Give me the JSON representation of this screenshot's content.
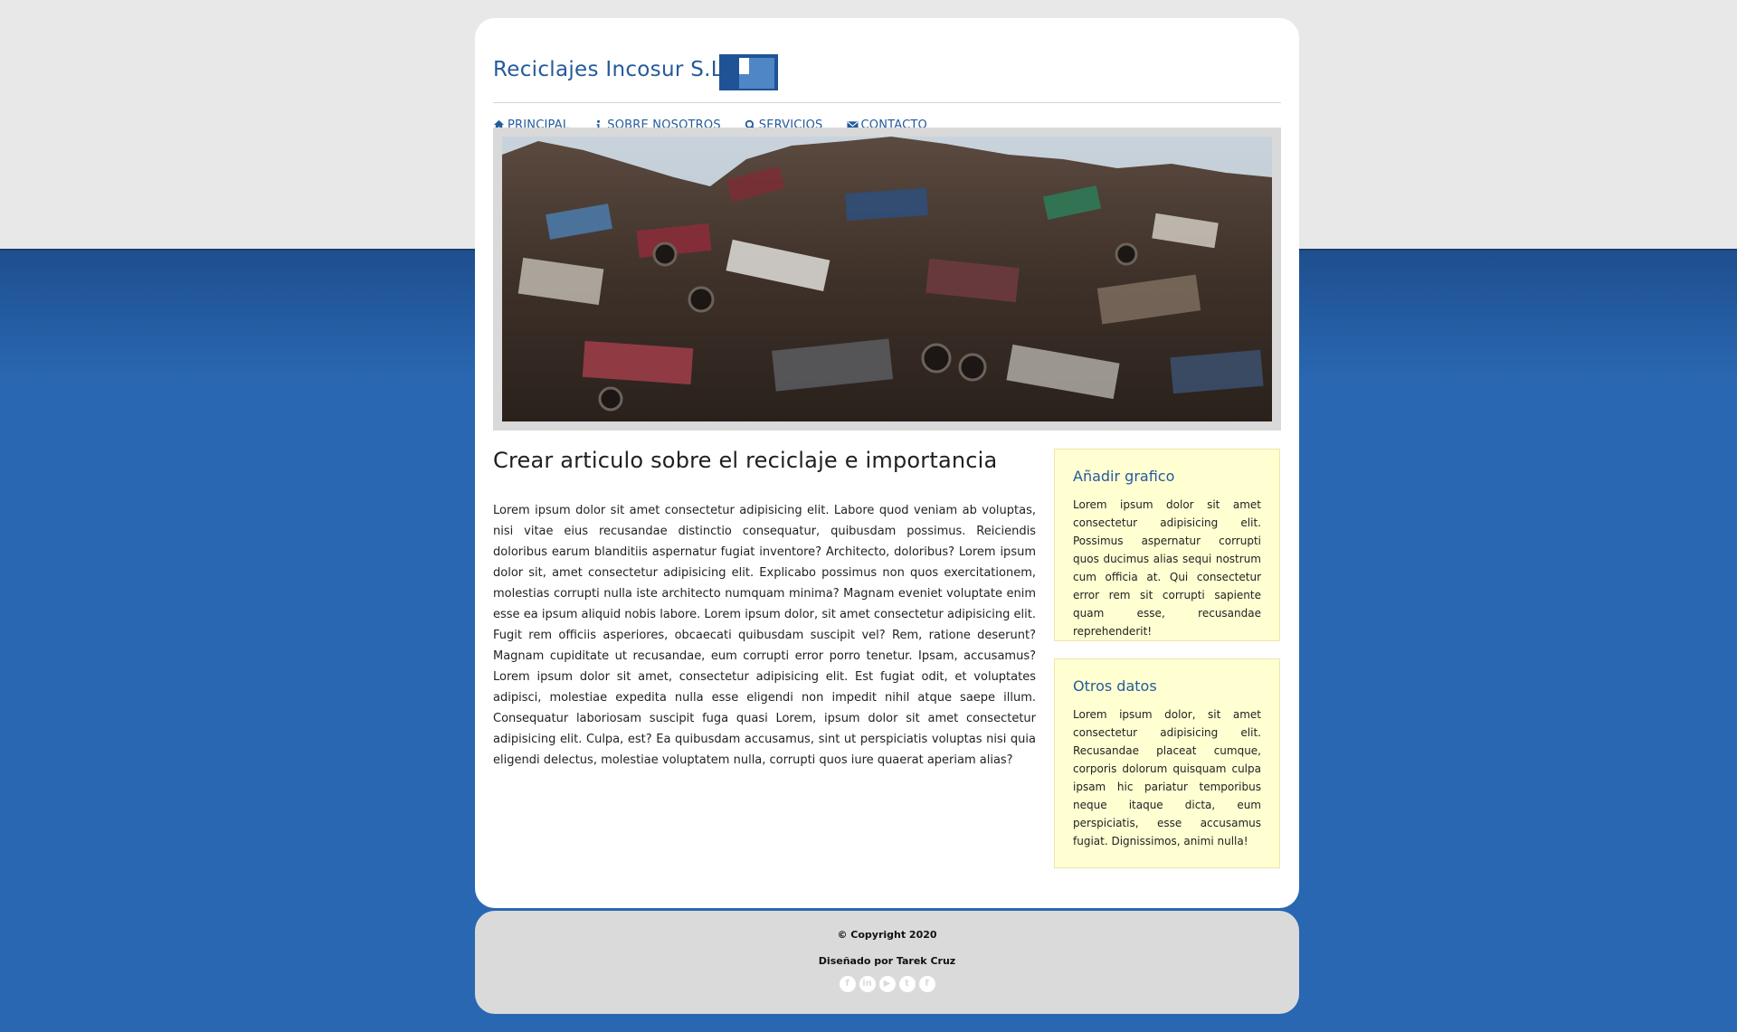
{
  "colors": {
    "brand_blue": "#245a9c",
    "page_background_top": "#e8e8e8",
    "page_background_bottom": "#2a67b2",
    "sidebar_box": "#ffffd2",
    "footer": "#dadada"
  },
  "header": {
    "site_title": "Reciclajes Incosur S.L",
    "logo_icon": "square-logo-icon"
  },
  "nav": {
    "items": [
      {
        "label": "PRINCIPAL",
        "icon": "home-icon"
      },
      {
        "label": "SOBRE NOSOTROS",
        "icon": "info-icon"
      },
      {
        "label": "SERVICIOS",
        "icon": "search-icon"
      },
      {
        "label": "CONTACTO",
        "icon": "envelope-icon"
      }
    ]
  },
  "hero": {
    "image": "scrap-metal-pile-photo"
  },
  "article": {
    "title": "Crear articulo sobre el reciclaje e importancia",
    "body": "Lorem ipsum dolor sit amet consectetur adipisicing elit. Labore quod veniam ab voluptas, nisi vitae eius recusandae distinctio consequatur, quibusdam possimus. Reiciendis doloribus earum blanditiis aspernatur fugiat inventore? Architecto, doloribus? Lorem ipsum dolor sit, amet consectetur adipisicing elit. Explicabo possimus non quos exercitationem, molestias corrupti nulla iste architecto numquam minima? Magnam eveniet voluptate enim esse ea ipsum aliquid nobis labore. Lorem ipsum dolor, sit amet consectetur adipisicing elit. Fugit rem officiis asperiores, obcaecati quibusdam suscipit vel? Rem, ratione deserunt? Magnam cupiditate ut recusandae, eum corrupti error porro tenetur. Ipsam, accusamus? Lorem ipsum dolor sit amet, consectetur adipisicing elit. Est fugiat odit, et voluptates adipisci, molestiae expedita nulla esse eligendi non impedit nihil atque saepe illum. Consequatur laboriosam suscipit fuga quasi Lorem, ipsum dolor sit amet consectetur adipisicing elit. Culpa, est? Ea quibusdam accusamus, sint ut perspiciatis voluptas nisi quia eligendi delectus, molestiae voluptatem nulla, corrupti quos iure quaerat aperiam alias?"
  },
  "sidebar": {
    "boxes": [
      {
        "title": "Añadir grafico",
        "text": "Lorem ipsum dolor sit amet consectetur adipisicing elit. Possimus aspernatur corrupti quos ducimus alias sequi nostrum cum officia at. Qui consectetur error rem sit corrupti sapiente quam esse, recusandae reprehenderit!"
      },
      {
        "title": "Otros datos",
        "text": "Lorem ipsum dolor, sit amet consectetur adipisicing elit. Recusandae placeat cumque, corporis dolorum quisquam culpa ipsam hic pariatur temporibus neque itaque dicta, eum perspiciatis, esse accusamus fugiat. Dignissimos, animi nulla!"
      }
    ]
  },
  "footer": {
    "copyright": "© Copyright 2020",
    "designer": "Diseñado por Tarek Cruz",
    "social_icons": [
      "facebook-icon",
      "linkedin-icon",
      "youtube-icon",
      "twitter-icon",
      "facebook-icon"
    ]
  }
}
